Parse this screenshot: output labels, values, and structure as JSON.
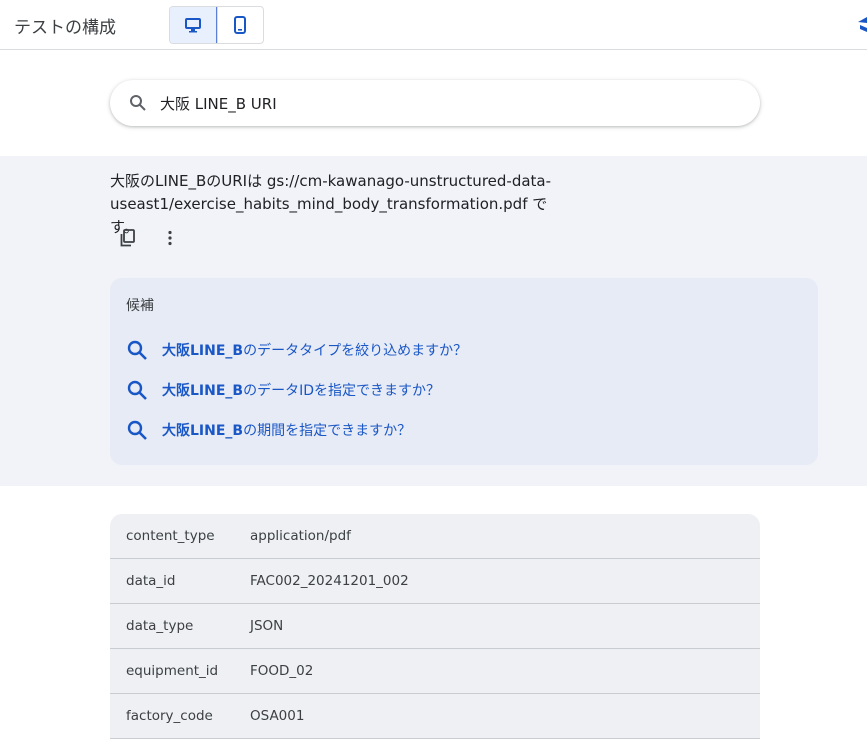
{
  "header": {
    "title": "テストの構成",
    "view_toggle": [
      {
        "icon": "desktop-icon",
        "selected": true
      },
      {
        "icon": "mobile-icon",
        "selected": false
      }
    ]
  },
  "search": {
    "query": "大阪 LINE_B URI"
  },
  "answer": {
    "text": "大阪のLINE_BのURIは gs://cm-kawanago-unstructured-data-useast1/exercise_habits_mind_body_transformation.pdf です。",
    "actions": [
      "copy-icon",
      "more-vert-icon"
    ]
  },
  "suggestions": {
    "title": "候補",
    "items": [
      {
        "bold": "大阪LINE_B",
        "rest": "のデータタイプを絞り込めますか？"
      },
      {
        "bold": "大阪LINE_B",
        "rest": "のデータIDを指定できますか？"
      },
      {
        "bold": "大阪LINE_B",
        "rest": "の期間を指定できますか？"
      }
    ]
  },
  "metadata_table": {
    "rows": [
      {
        "key": "content_type",
        "value": "application/pdf"
      },
      {
        "key": "data_id",
        "value": "FAC002_20241201_002"
      },
      {
        "key": "data_type",
        "value": "JSON"
      },
      {
        "key": "equipment_id",
        "value": "FOOD_02"
      },
      {
        "key": "factory_code",
        "value": "OSA001"
      }
    ]
  },
  "colors": {
    "accent_link": "#1a57c6",
    "answer_bg": "#f1f3f8",
    "suggest_bg": "#e7ebf5",
    "table_bg": "#eef0f4"
  }
}
